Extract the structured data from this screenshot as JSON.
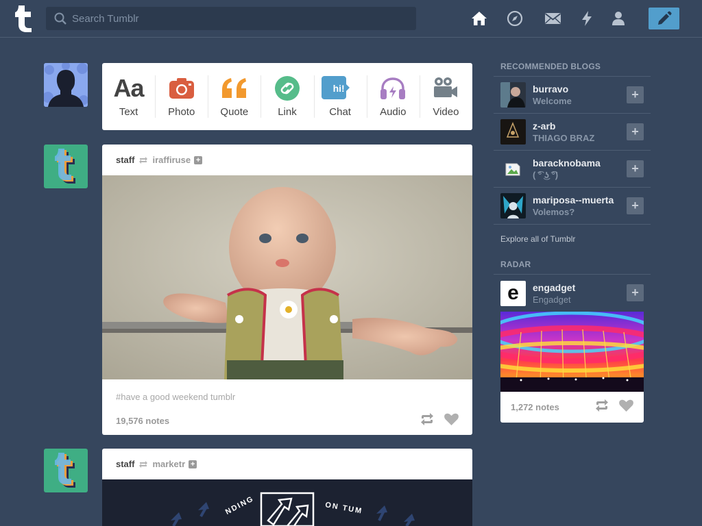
{
  "header": {
    "search": {
      "placeholder": "Search Tumblr",
      "value": ""
    },
    "nav_icons": [
      "home-icon",
      "explore-compass-icon",
      "inbox-envelope-icon",
      "activity-lightning-icon",
      "account-person-icon"
    ],
    "compose_icon": "pencil-icon"
  },
  "post_types": [
    {
      "label": "Text",
      "icon": "text-aa-icon",
      "glyph": "Aa",
      "color": "#444444"
    },
    {
      "label": "Photo",
      "icon": "camera-icon",
      "color": "#d95e40"
    },
    {
      "label": "Quote",
      "icon": "quote-icon",
      "glyph": "66",
      "color": "#f2992e"
    },
    {
      "label": "Link",
      "icon": "link-icon",
      "color": "#56bc8a"
    },
    {
      "label": "Chat",
      "icon": "chat-bubble-icon",
      "glyph": "hi!",
      "color": "#529ecc"
    },
    {
      "label": "Audio",
      "icon": "headphones-icon",
      "color": "#a77dc2"
    },
    {
      "label": "Video",
      "icon": "video-camera-icon",
      "color": "#748089"
    }
  ],
  "posts": [
    {
      "author": "staff",
      "source": "iraffiruse",
      "tags": "#have a good weekend tumblr",
      "notes": "19,576 notes"
    },
    {
      "author": "staff",
      "source": "marketr",
      "image_text_left": "NDING",
      "image_text_right": "ON TUM"
    }
  ],
  "sidebar": {
    "recommended_title": "RECOMMENDED BLOGS",
    "blogs": [
      {
        "name": "burravo",
        "subtitle": "Welcome"
      },
      {
        "name": "z-arb",
        "subtitle": "THIAGO BRAZ"
      },
      {
        "name": "baracknobama",
        "subtitle": "( ͡° ͜ʖ ͡°)"
      },
      {
        "name": "mariposa--muerta",
        "subtitle": "Volemos?"
      }
    ],
    "explore_label": "Explore all of Tumblr",
    "radar_title": "RADAR",
    "radar": {
      "name": "engadget",
      "subtitle": "Engadget",
      "logo_letter": "e",
      "notes": "1,272 notes"
    }
  },
  "colors": {
    "background": "#36465d",
    "compose_button": "#529ecc",
    "card": "#ffffff"
  }
}
